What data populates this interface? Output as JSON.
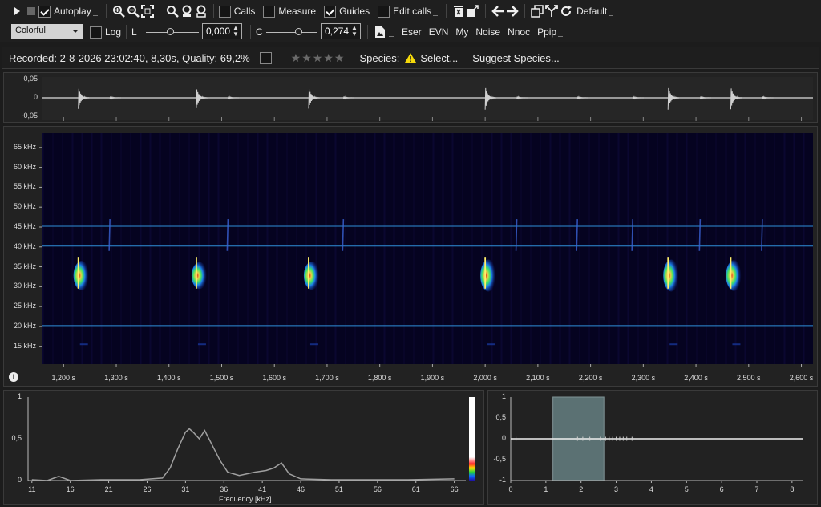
{
  "toolbar": {
    "autoplay_label": "Autoplay",
    "calls_label": "Calls",
    "measure_label": "Measure",
    "guides_label": "Guides",
    "edit_calls_label": "Edit calls",
    "default_label": "Default",
    "autoplay_checked": true,
    "calls_checked": false,
    "measure_checked": false,
    "guides_checked": true,
    "edit_calls_checked": false,
    "colormap": "Colorful",
    "log_label": "Log",
    "log_checked": false,
    "l_label": "L",
    "l_value": "0,000",
    "c_label": "C",
    "c_value": "0,274",
    "filters": [
      "Eser",
      "EVN",
      "My",
      "Noise",
      "Nnoc",
      "Ppip"
    ]
  },
  "info": {
    "recorded": "Recorded: 2-8-2026 23:02:40, 8,30s, Quality: 69,2%",
    "species_label": "Species:",
    "select_label": "Select...",
    "suggest_label": "Suggest Species...",
    "rating": 0,
    "max_rating": 5
  },
  "waveform": {
    "y_ticks": [
      "0,05",
      "0",
      "-0,05"
    ]
  },
  "spectrogram": {
    "y_ticks": [
      "65 kHz",
      "60 kHz",
      "55 kHz",
      "50 kHz",
      "45 kHz",
      "40 kHz",
      "35 kHz",
      "30 kHz",
      "25 kHz",
      "20 kHz",
      "15 kHz"
    ],
    "x_ticks": [
      "1,200 s",
      "1,300 s",
      "1,400 s",
      "1,500 s",
      "1,600 s",
      "1,700 s",
      "1,800 s",
      "1,900 s",
      "2,000 s",
      "2,100 s",
      "2,200 s",
      "2,300 s",
      "2,400 s",
      "2,500 s",
      "2,600 s"
    ],
    "guide_lines_khz": [
      45.2,
      40.2,
      20.2
    ],
    "calls": [
      {
        "t": 1.228,
        "strength": 0.9
      },
      {
        "t": 1.452,
        "strength": 0.8
      },
      {
        "t": 1.665,
        "strength": 0.85
      },
      {
        "t": 2.0,
        "strength": 1.0
      },
      {
        "t": 2.347,
        "strength": 1.0
      },
      {
        "t": 2.466,
        "strength": 0.95
      }
    ],
    "weak_calls": [
      1.288,
      1.512,
      1.731,
      2.06,
      2.175,
      2.28,
      2.408,
      2.526
    ],
    "colors": {
      "background": "#050320",
      "guide": "#2f8fd8"
    }
  },
  "power_spectrum": {
    "y_ticks": [
      "1",
      "0,5",
      "0"
    ],
    "x_ticks": [
      "11",
      "16",
      "21",
      "26",
      "31",
      "36",
      "41",
      "46",
      "51",
      "56",
      "61",
      "66"
    ],
    "xlabel": "Frequency [kHz]"
  },
  "chart_data": {
    "type": "line",
    "x": [
      11,
      13,
      14.5,
      16,
      20,
      25,
      28,
      29,
      30,
      31,
      31.5,
      32,
      32.8,
      33.5,
      34.5,
      35.5,
      36.5,
      38,
      40,
      41.5,
      42.5,
      43.5,
      44.5,
      46,
      50,
      60,
      66
    ],
    "series": [
      {
        "values": [
          0.01,
          0.0,
          0.05,
          0.0,
          0.01,
          0.01,
          0.03,
          0.15,
          0.38,
          0.58,
          0.62,
          0.58,
          0.5,
          0.6,
          0.42,
          0.24,
          0.1,
          0.06,
          0.1,
          0.12,
          0.15,
          0.21,
          0.08,
          0.02,
          0.01,
          0.01,
          0.02
        ]
      }
    ],
    "xlabel": "Frequency [kHz]",
    "ylim": [
      0,
      1
    ],
    "xlim": [
      10.5,
      67.5
    ]
  },
  "pulse_plot": {
    "y_ticks": [
      "1",
      "0,5",
      "0",
      "-0,5",
      "-1"
    ],
    "x_ticks": [
      "0",
      "1",
      "2",
      "3",
      "4",
      "5",
      "6",
      "7",
      "8"
    ],
    "xlim": [
      0,
      8.3
    ],
    "ylim": [
      -1,
      1
    ],
    "selection": [
      1.2,
      2.65
    ]
  }
}
